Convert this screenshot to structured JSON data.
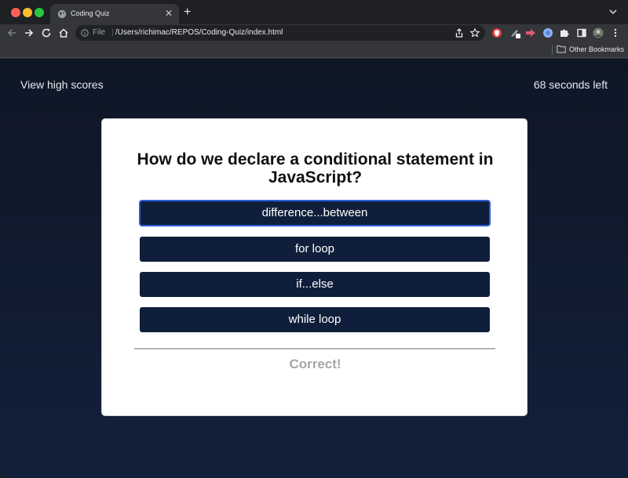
{
  "browser": {
    "tab_title": "Coding Quiz",
    "tab_close": "✕",
    "new_tab": "+",
    "file_label": "File",
    "url_separator": "|",
    "url": "/Users/richimac/REPOS/Coding-Quiz/index.html",
    "bookmark_label": "Other Bookmarks"
  },
  "header": {
    "high_scores_link": "View high scores",
    "timer_text": "68 seconds left"
  },
  "quiz": {
    "question": "How do we declare a conditional statement in JavaScript?",
    "answers": [
      "difference...between",
      "for loop",
      "if...else",
      "while loop"
    ],
    "feedback": "Correct!"
  },
  "colors": {
    "page_bg": "#0f1726",
    "answer_bg": "#0f1f3b",
    "feedback": "#a6a6a6"
  }
}
